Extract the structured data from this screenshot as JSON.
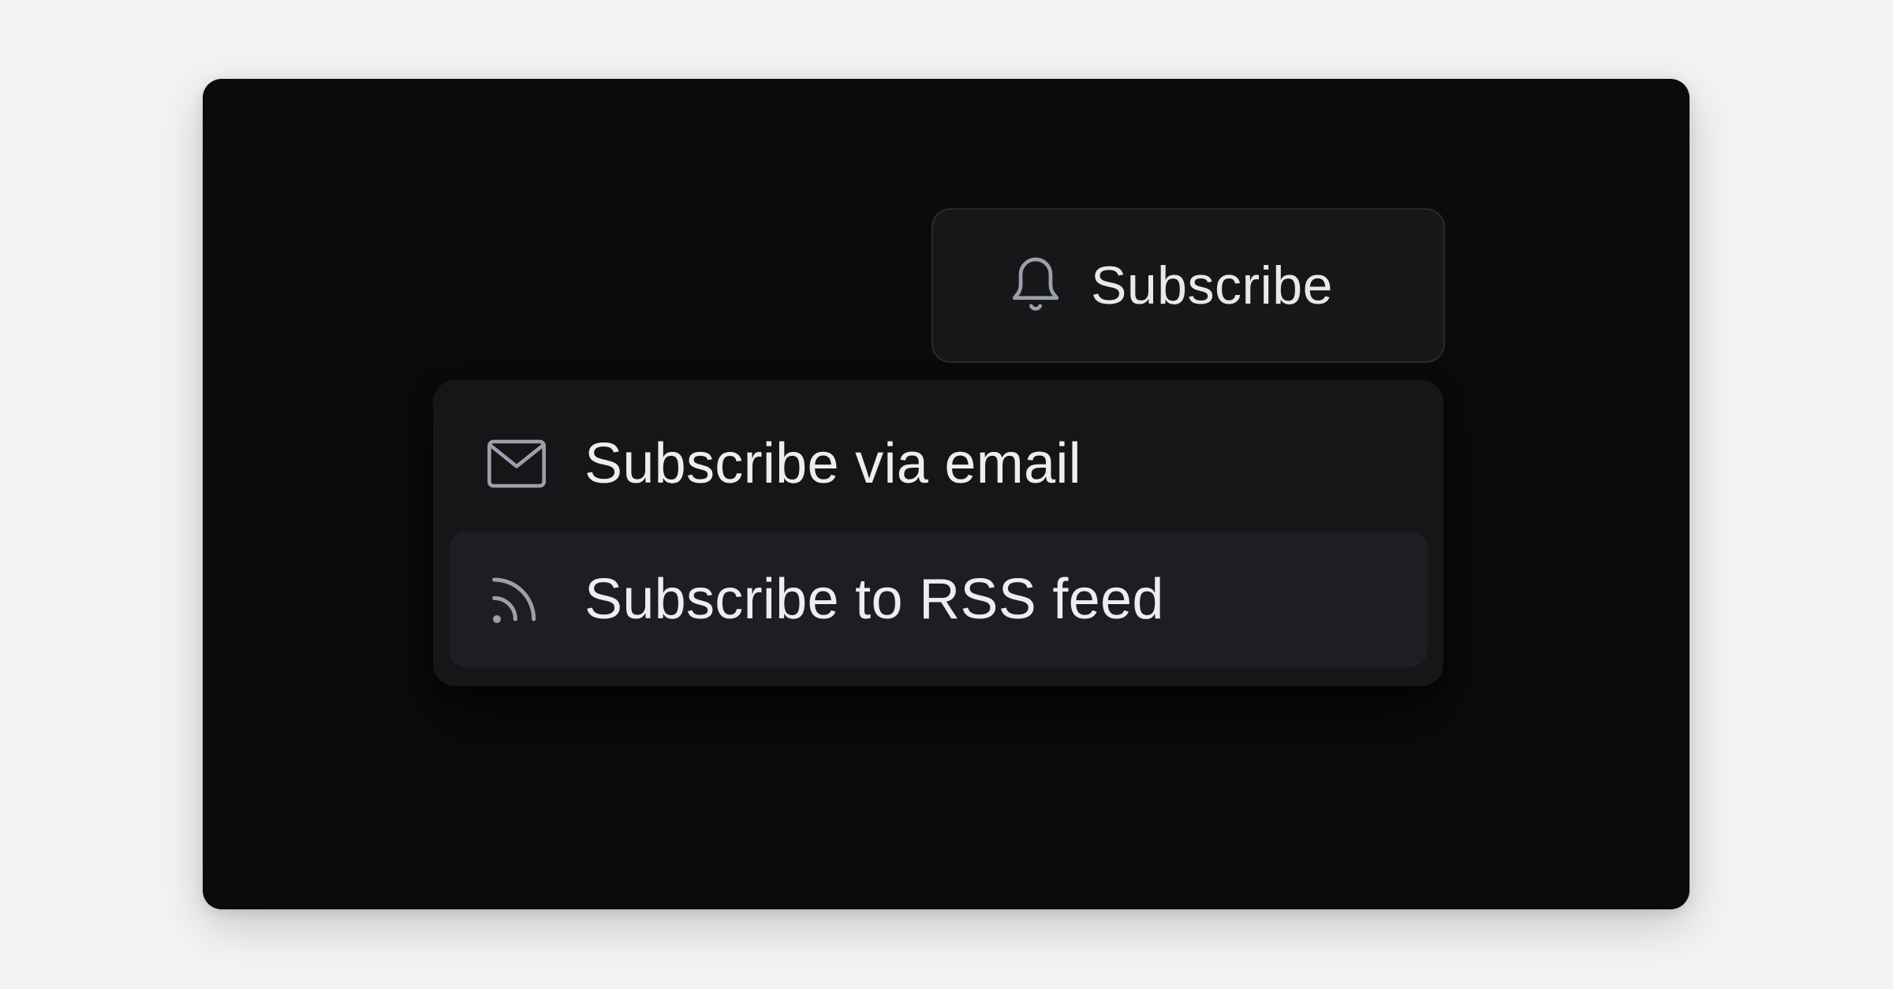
{
  "subscribe_button": {
    "label": "Subscribe",
    "icon": "bell-icon"
  },
  "menu": {
    "items": [
      {
        "label": "Subscribe via email",
        "icon": "envelope-icon",
        "highlighted": false
      },
      {
        "label": "Subscribe to RSS feed",
        "icon": "rss-icon",
        "highlighted": true
      }
    ]
  },
  "colors": {
    "page_background": "#f3f3f4",
    "stage_background": "#0b0b0c",
    "surface": "#161619",
    "surface_hover": "#1e1e22",
    "text": "#eeeef1",
    "icon": "#9aa0ad"
  }
}
